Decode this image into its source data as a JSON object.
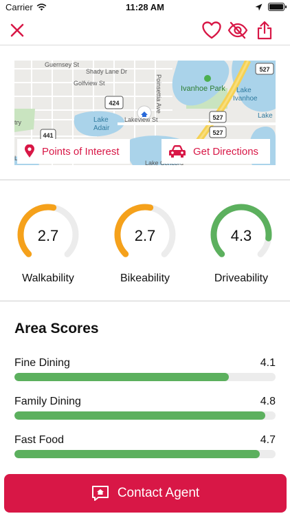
{
  "status_bar": {
    "carrier": "Carrier",
    "time": "11:28 AM"
  },
  "toolbar": {
    "close_icon": "close-icon",
    "favorite_icon": "heart-icon",
    "hide_icon": "eye-slash-icon",
    "share_icon": "share-icon",
    "accent_color": "#d81746"
  },
  "map": {
    "labels": {
      "guernsey": "Guernsey St",
      "shady_lane": "Shady Lane Dr",
      "golfview": "Golfview St",
      "ivanhoe_park": "Ivanhoe Park",
      "lake_ivanhoe_1": "Lake",
      "lake_ivanhoe_2": "Ivanhoe",
      "lake_adair_1": "Lake",
      "lake_adair_2": "Adair",
      "lakeview": "Lakeview St",
      "poinsettia": "Poinsettia Ave",
      "lake_concord": "Lake Concord",
      "lake_left": "Lake",
      "try": "try",
      "road_424": "424",
      "road_441": "441",
      "road_527a": "527",
      "road_527b": "527",
      "road_527c": "527"
    },
    "points_of_interest_label": "Points of Interest",
    "get_directions_label": "Get Directions"
  },
  "gauges": [
    {
      "label": "Walkability",
      "value": "2.7",
      "fraction": 0.54,
      "color": "#f5a11b"
    },
    {
      "label": "Bikeability",
      "value": "2.7",
      "fraction": 0.54,
      "color": "#f5a11b"
    },
    {
      "label": "Driveability",
      "value": "4.3",
      "fraction": 0.86,
      "color": "#5cb05e"
    }
  ],
  "area_scores": {
    "title": "Area Scores",
    "items": [
      {
        "name": "Fine Dining",
        "score": "4.1",
        "fraction": 0.82
      },
      {
        "name": "Family Dining",
        "score": "4.8",
        "fraction": 0.96
      },
      {
        "name": "Fast Food",
        "score": "4.7",
        "fraction": 0.94
      }
    ]
  },
  "contact_button": {
    "label": "Contact Agent",
    "icon": "agent-chat-icon"
  }
}
